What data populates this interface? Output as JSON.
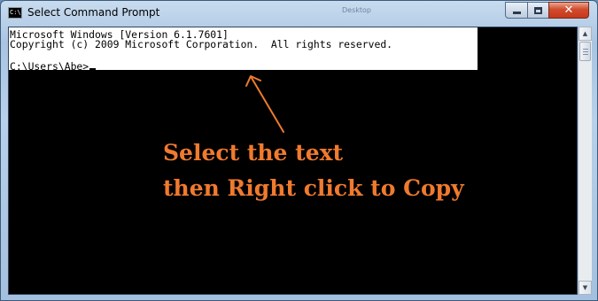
{
  "window": {
    "title": "Select Command Prompt",
    "icon_text": "C:\\",
    "background_label": "Desktop"
  },
  "controls": {
    "minimize": "minimize",
    "maximize": "maximize",
    "close": "✕"
  },
  "console": {
    "lines": [
      "Microsoft Windows [Version 6.1.7601]",
      "Copyright (c) 2009 Microsoft Corporation.  All rights reserved.",
      "",
      "C:\\Users\\Abe>"
    ]
  },
  "annotation": {
    "line1": "Select the text",
    "line2": "then Right click to Copy",
    "color": "#f07a2e"
  },
  "scrollbar": {
    "up_arrow": "▲",
    "down_arrow": "▼"
  }
}
